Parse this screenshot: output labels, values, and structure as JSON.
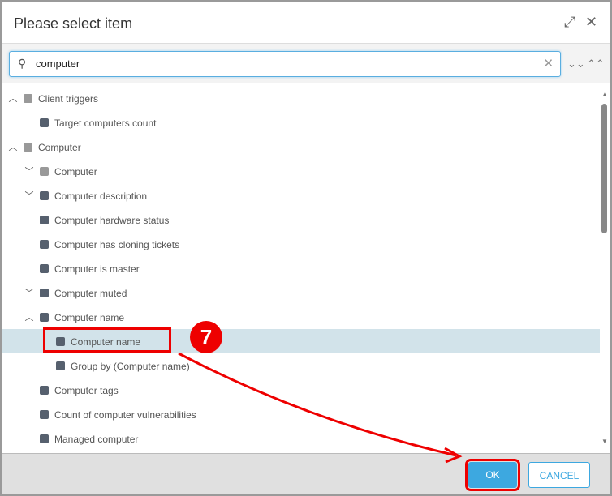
{
  "dialog": {
    "title": "Please select item",
    "expand_icon": "expand-icon",
    "close_icon": "close-icon"
  },
  "search": {
    "value": "computer",
    "icon": "search-icon"
  },
  "tree": [
    {
      "label": "Client triggers",
      "level": 0,
      "chevron": "up",
      "kind": "group"
    },
    {
      "label": "Target computers count",
      "level": 1,
      "chevron": "none",
      "kind": "item"
    },
    {
      "label": "Computer",
      "level": 0,
      "chevron": "up",
      "kind": "group"
    },
    {
      "label": "Computer",
      "level": 1,
      "chevron": "down",
      "kind": "group"
    },
    {
      "label": "Computer description",
      "level": 1,
      "chevron": "down",
      "kind": "item"
    },
    {
      "label": "Computer hardware status",
      "level": 1,
      "chevron": "none",
      "kind": "item"
    },
    {
      "label": "Computer has cloning tickets",
      "level": 1,
      "chevron": "none",
      "kind": "item"
    },
    {
      "label": "Computer is master",
      "level": 1,
      "chevron": "none",
      "kind": "item"
    },
    {
      "label": "Computer muted",
      "level": 1,
      "chevron": "down",
      "kind": "item"
    },
    {
      "label": "Computer name",
      "level": 1,
      "chevron": "up",
      "kind": "item"
    },
    {
      "label": "Computer name",
      "level": 2,
      "chevron": "none",
      "kind": "item",
      "selected": true
    },
    {
      "label": "Group by (Computer name)",
      "level": 2,
      "chevron": "none",
      "kind": "item"
    },
    {
      "label": "Computer tags",
      "level": 1,
      "chevron": "none",
      "kind": "item"
    },
    {
      "label": "Count of computer vulnerabilities",
      "level": 1,
      "chevron": "none",
      "kind": "item"
    },
    {
      "label": "Managed computer",
      "level": 1,
      "chevron": "none",
      "kind": "item"
    }
  ],
  "footer": {
    "ok": "OK",
    "cancel": "CANCEL"
  },
  "annotation": {
    "step": "7"
  },
  "colors": {
    "accent": "#3da8e0",
    "selected": "#d2e3ea",
    "annotation": "#e00000",
    "group_icon": "#999999",
    "item_icon": "#56606e"
  }
}
